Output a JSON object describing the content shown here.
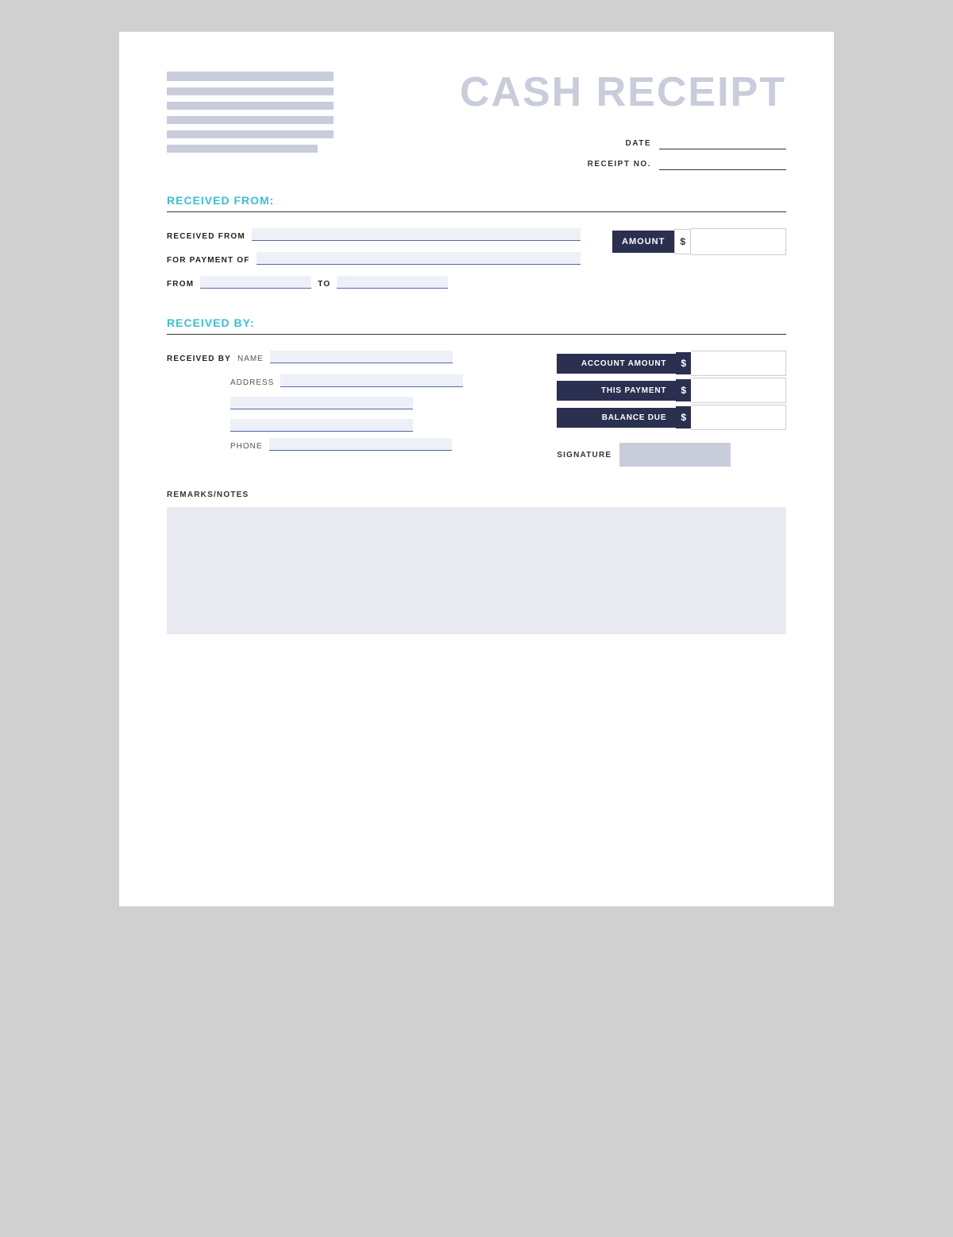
{
  "header": {
    "title": "CASH RECEIPT",
    "date_label": "DATE",
    "receipt_no_label": "RECEIPT NO."
  },
  "sections": {
    "received_from_title": "RECEIVED FROM:",
    "received_by_title": "RECEIVED BY:"
  },
  "fields": {
    "received_from_label": "RECEIVED FROM",
    "for_payment_of_label": "FOR PAYMENT OF",
    "from_label": "FROM",
    "to_label": "TO",
    "amount_label": "AMOUNT",
    "dollar_sign": "$",
    "received_by_label": "RECEIVED BY",
    "name_label": "NAME",
    "address_label": "ADDRESS",
    "phone_label": "PHONE",
    "account_amount_label": "ACCOUNT AMOUNT",
    "this_payment_label": "THIS PAYMENT",
    "balance_due_label": "BALANCE DUE",
    "signature_label": "SIGNATURE",
    "remarks_label": "REMARKS/NOTES"
  }
}
